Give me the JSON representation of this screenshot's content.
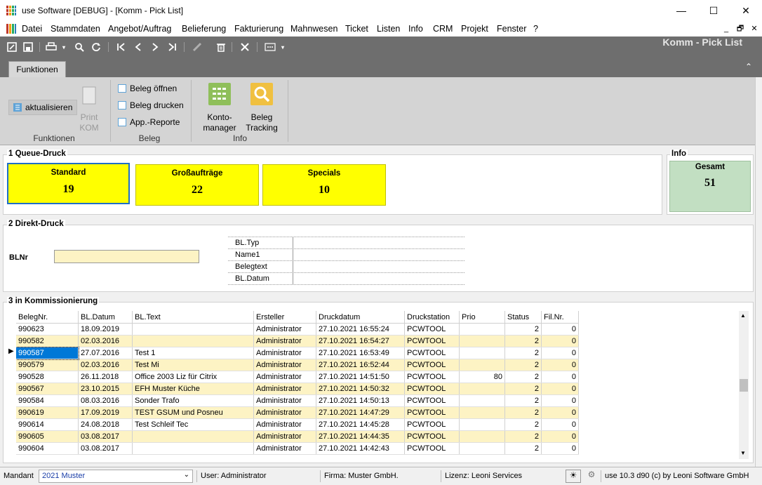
{
  "window": {
    "title": "use Software [DEBUG] - [Komm - Pick List]",
    "minimize": "—",
    "maximize": "☐",
    "close": "✕"
  },
  "menu": {
    "items": [
      "Datei",
      "Stammdaten",
      "Angebot/Auftrag",
      "Belieferung",
      "Fakturierung",
      "Mahnwesen",
      "Ticket",
      "Listen",
      "Info",
      "CRM",
      "Projekt",
      "Fenster",
      "?"
    ],
    "mdi_min": "_",
    "mdi_restore": "🗗",
    "mdi_close": "✕"
  },
  "page_title": "Komm - Pick List",
  "ribbon": {
    "tab": "Funktionen",
    "collapse": "⌃",
    "groups": {
      "funktionen": {
        "label": "Funktionen",
        "aktualisieren": "aktualisieren",
        "print_kom": "Print\nKOM"
      },
      "beleg": {
        "label": "Beleg",
        "open": "Beleg öffnen",
        "print": "Beleg drucken",
        "reports": "App.-Reporte"
      },
      "info": {
        "label": "Info",
        "konto1": "Konto-",
        "konto2": "manager",
        "track1": "Beleg",
        "track2": "Tracking"
      }
    }
  },
  "queue": {
    "title": "1 Queue-Druck",
    "tiles": [
      {
        "label": "Standard",
        "count": "19"
      },
      {
        "label": "Großaufträge",
        "count": "22"
      },
      {
        "label": "Specials",
        "count": "10"
      }
    ]
  },
  "info_box": {
    "title": "Info",
    "label": "Gesamt",
    "count": "51"
  },
  "direkt": {
    "title": "2 Direkt-Druck",
    "blnr_label": "BLNr",
    "blnr_value": "",
    "fields": [
      "BL.Typ",
      "Name1",
      "Belegtext",
      "BL.Datum"
    ]
  },
  "komm": {
    "title": "3 in Kommissionierung",
    "columns": [
      "BelegNr.",
      "BL.Datum",
      "BL.Text",
      "Ersteller",
      "Druckdatum",
      "Druckstation",
      "Prio",
      "Status",
      "Fil.Nr."
    ],
    "rows": [
      [
        "990623",
        "18.09.2019",
        "",
        "Administrator",
        "27.10.2021 16:55:24",
        "PCWTOOL",
        "",
        "2",
        "0"
      ],
      [
        "990582",
        "02.03.2016",
        "",
        "Administrator",
        "27.10.2021 16:54:27",
        "PCWTOOL",
        "",
        "2",
        "0"
      ],
      [
        "990587",
        "27.07.2016",
        "Test 1",
        "Administrator",
        "27.10.2021 16:53:49",
        "PCWTOOL",
        "",
        "2",
        "0"
      ],
      [
        "990579",
        "02.03.2016",
        "Test Mi",
        "Administrator",
        "27.10.2021 16:52:44",
        "PCWTOOL",
        "",
        "2",
        "0"
      ],
      [
        "990528",
        "26.11.2018",
        "Office 2003 Liz für Citrix",
        "Administrator",
        "27.10.2021 14:51:50",
        "PCWTOOL",
        "80",
        "2",
        "0"
      ],
      [
        "990567",
        "23.10.2015",
        "EFH Muster Küche",
        "Administrator",
        "27.10.2021 14:50:32",
        "PCWTOOL",
        "",
        "2",
        "0"
      ],
      [
        "990584",
        "08.03.2016",
        "Sonder Trafo",
        "Administrator",
        "27.10.2021 14:50:13",
        "PCWTOOL",
        "",
        "2",
        "0"
      ],
      [
        "990619",
        "17.09.2019",
        "TEST GSUM und Posneu",
        "Administrator",
        "27.10.2021 14:47:29",
        "PCWTOOL",
        "",
        "2",
        "0"
      ],
      [
        "990614",
        "24.08.2018",
        "Test Schleif Tec",
        "Administrator",
        "27.10.2021 14:45:28",
        "PCWTOOL",
        "",
        "2",
        "0"
      ],
      [
        "990605",
        "03.08.2017",
        "",
        "Administrator",
        "27.10.2021 14:44:35",
        "PCWTOOL",
        "",
        "2",
        "0"
      ],
      [
        "990604",
        "03.08.2017",
        "",
        "Administrator",
        "27.10.2021 14:42:43",
        "PCWTOOL",
        "",
        "2",
        "0"
      ]
    ],
    "row_marker": "▶"
  },
  "status": {
    "mandant_label": "Mandant",
    "mandant_value": "2021 Muster",
    "user": "User: Administrator",
    "firma": "Firma: Muster GmbH.",
    "lizenz": "Lizenz: Leoni Services",
    "version": "use 10.3 d90 (c) by Leoni Software GmbH"
  }
}
